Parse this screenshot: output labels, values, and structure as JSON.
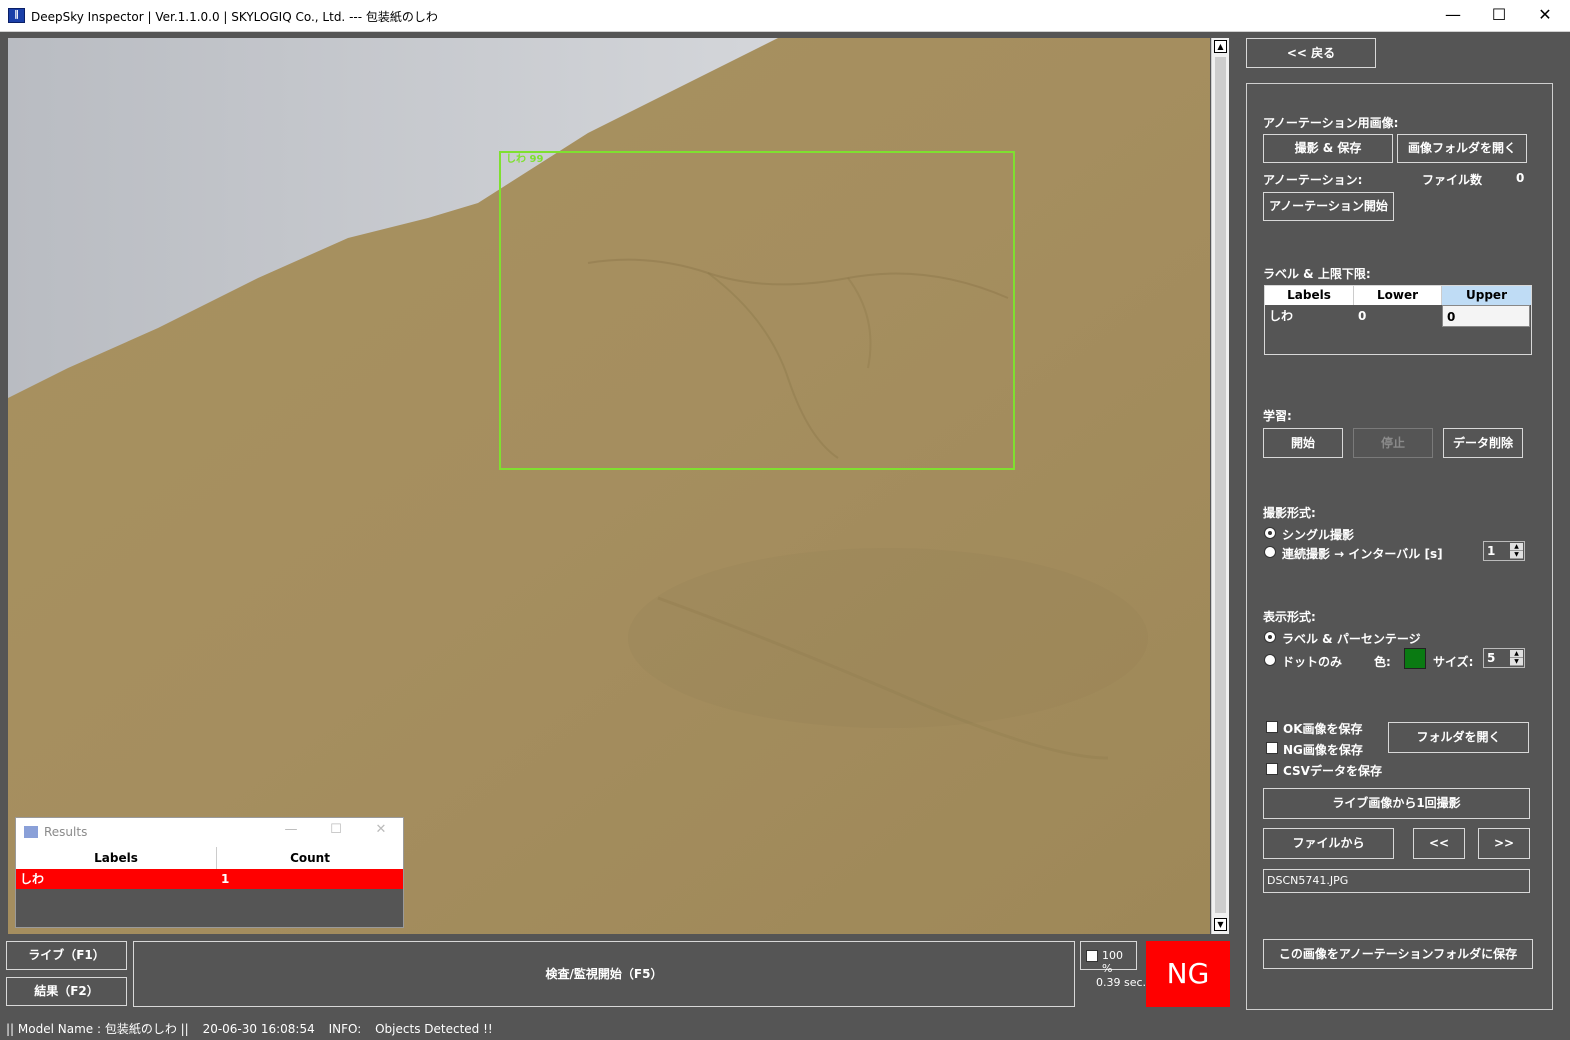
{
  "window": {
    "title": "DeepSky Inspector | Ver.1.1.0.0 | SKYLOGIQ Co., Ltd. --- 包装紙のしわ",
    "icon": "app-logo-icon",
    "controls": {
      "minimize": "—",
      "maximize": "☐",
      "close": "✕"
    }
  },
  "viewer": {
    "detection_label": "しわ 99",
    "detection_color": "#7fe030"
  },
  "results_window": {
    "title": "Results",
    "columns": [
      "Labels",
      "Count"
    ],
    "rows": [
      {
        "label": "しわ",
        "count": "1"
      }
    ],
    "row_color": "#ff0000"
  },
  "bottom": {
    "live_button": "ライブ（F1）",
    "result_button": "結果（F2）",
    "inspect_button": "検査/監視開始（F5）",
    "zoom": "100 %",
    "elapsed": "0.39 sec.",
    "verdict": "NG",
    "verdict_color": "#ff0000"
  },
  "panel": {
    "back_button": "<< 戻る",
    "annotation_image_label": "アノーテーション用画像:",
    "capture_save_button": "撮影 & 保存",
    "open_image_folder_button": "画像フォルダを開く",
    "annotation_label": "アノーテーション:",
    "file_count_label": "ファイル数",
    "file_count": "0",
    "start_annotation_button": "アノーテーション開始",
    "limits_label": "ラベル & 上限下限:",
    "limits_columns": [
      "Labels",
      "Lower",
      "Upper"
    ],
    "limits_rows": [
      {
        "label": "しわ",
        "lower": "0",
        "upper": "0"
      }
    ],
    "training_label": "学習:",
    "train_start_button": "開始",
    "train_stop_button": "停止",
    "delete_data_button": "データ削除",
    "capture_mode_label": "撮影形式:",
    "single_capture": "シングル撮影",
    "continuous_capture": "連続撮影 → インターバル [s]",
    "interval_value": "1",
    "display_mode_label": "表示形式:",
    "label_percentage": "ラベル & パーセンテージ",
    "dots_only": "ドットのみ",
    "color_label": "色:",
    "dot_color": "#0a7a12",
    "size_label": "サイズ:",
    "size_value": "5",
    "save_ok": "OK画像を保存",
    "save_ng": "NG画像を保存",
    "save_csv": "CSVデータを保存",
    "open_folder_button": "フォルダを開く",
    "capture_from_live_button": "ライブ画像から1回撮影",
    "from_file_button": "ファイルから",
    "prev_button": "<<",
    "next_button": ">>",
    "filename": "DSCN5741.JPG",
    "save_to_annotation_button": "この画像をアノーテーションフォルダに保存"
  },
  "status": {
    "model": "|| Model Name : 包装紙のしわ ||",
    "timestamp": "20-06-30 16:08:54",
    "info_label": "INFO:",
    "info_text": "Objects Detected !!"
  }
}
